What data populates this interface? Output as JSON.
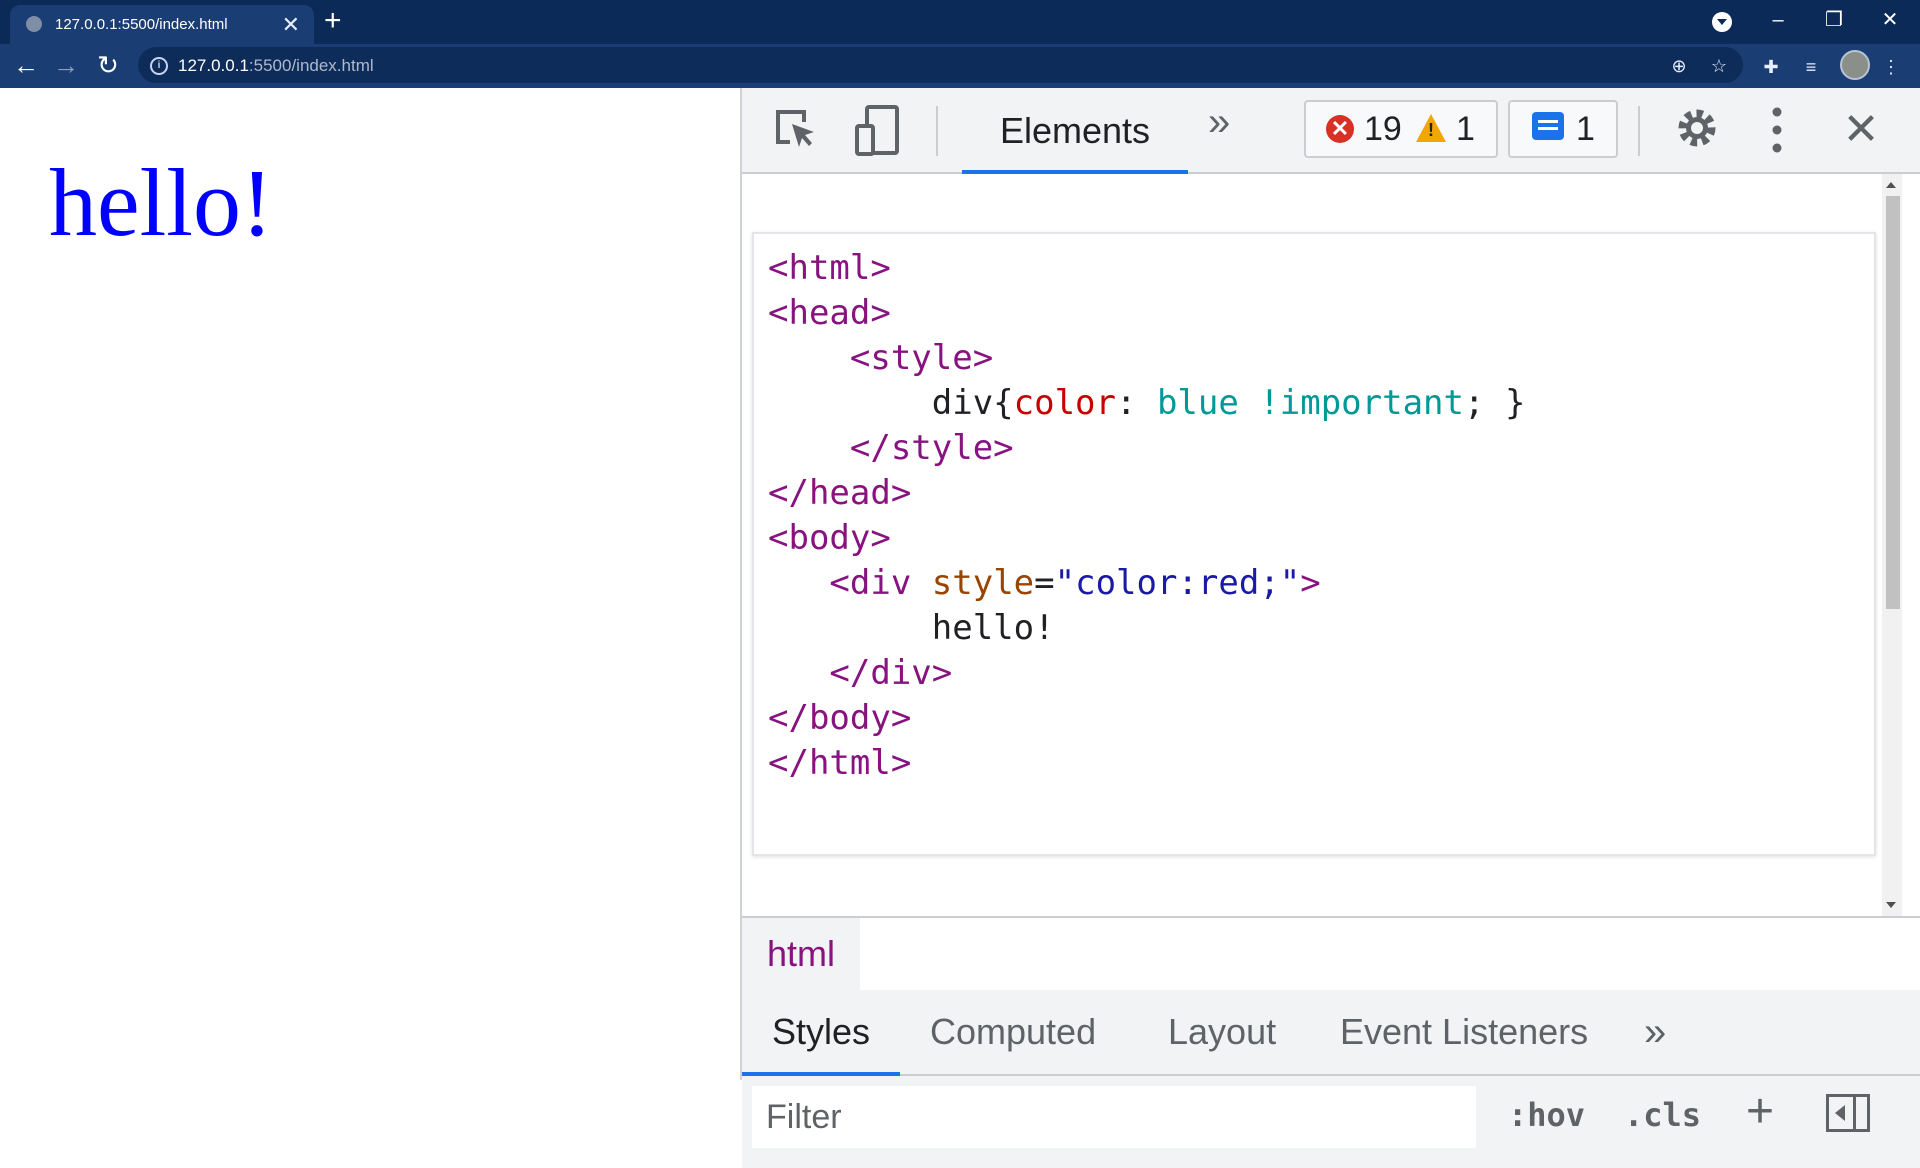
{
  "browser": {
    "tab_title": "127.0.0.1:5500/index.html",
    "tab_close": "✕",
    "new_tab": "+",
    "url_host": "127.0.0.1",
    "url_rest": ":5500/index.html",
    "window_controls": {
      "minimize": "–",
      "restore": "❐",
      "close": "✕"
    },
    "nav": {
      "back": "←",
      "forward": "→",
      "reload": "↻"
    }
  },
  "page": {
    "text": "hello!"
  },
  "devtools": {
    "active_tab": "Elements",
    "more_tabs": "»",
    "errors": "19",
    "warnings": "1",
    "messages": "1",
    "close": "✕",
    "breadcrumb": "html",
    "styles_tabs": [
      "Styles",
      "Computed",
      "Layout",
      "Event Listeners"
    ],
    "styles_more": "»",
    "filter_placeholder": "Filter",
    "hov": ":hov",
    "cls": ".cls",
    "plus": "+",
    "code_lines": [
      "<html>",
      "<head>",
      "    <style>",
      "        div{color: blue !important; }",
      "    </style>",
      "</head>",
      "<body>",
      "   <div style=\"color:red;\">",
      "        hello!",
      "   </div>",
      "</body>",
      "</html>"
    ]
  },
  "colors": {
    "tabbar": "#0b2a57",
    "toolbar": "#1a3d73",
    "accent": "#1a73e8",
    "tag": "#881280",
    "page_text": "#0000ff"
  }
}
